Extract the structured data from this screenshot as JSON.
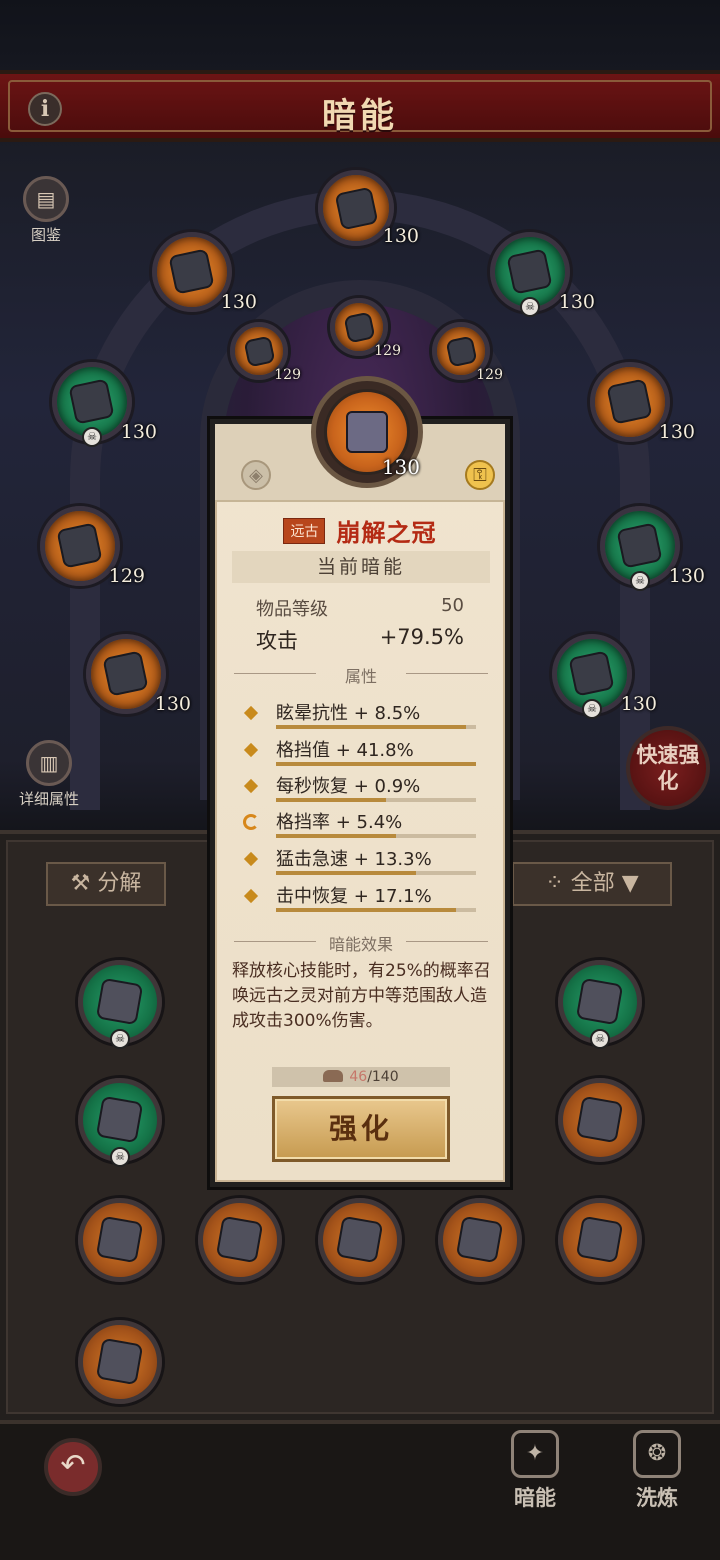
{
  "header": {
    "title": "暗能",
    "info_icon": "i"
  },
  "side": {
    "codex_label": "图鉴",
    "details_label": "详细属性",
    "quick_upgrade_label": "快速强化"
  },
  "ring_slots": [
    {
      "level": "130",
      "color": "orange"
    },
    {
      "level": "130",
      "color": "orange"
    },
    {
      "level": "130",
      "color": "green"
    },
    {
      "level": "129",
      "color": "orange"
    },
    {
      "level": "129",
      "color": "orange"
    },
    {
      "level": "129",
      "color": "orange"
    },
    {
      "level": "130",
      "color": "green"
    },
    {
      "level": "130",
      "color": "orange"
    },
    {
      "level": "129",
      "color": "orange"
    },
    {
      "level": "130",
      "color": "green"
    },
    {
      "level": "130",
      "color": "orange"
    },
    {
      "level": "130",
      "color": "green"
    }
  ],
  "lower": {
    "dismantle_label": "分解",
    "filter_label": "全部"
  },
  "popup": {
    "item_level": "130",
    "rarity": "远古",
    "item_name": "崩解之冠",
    "section_current": "当前暗能",
    "item_level_label": "物品等级",
    "item_level_value": "50",
    "attack_label": "攻击",
    "attack_value": "+79.5%",
    "attributes_title": "属性",
    "attributes": [
      {
        "text": "眩晕抗性 + 8.5%",
        "fill": 0.95
      },
      {
        "text": "格挡值 + 41.8%",
        "fill": 1.0
      },
      {
        "text": "每秒恢复 + 0.9%",
        "fill": 0.55
      },
      {
        "text": "格挡率 + 5.4%",
        "fill": 0.6
      },
      {
        "text": "猛击急速 + 13.3%",
        "fill": 0.7
      },
      {
        "text": "击中恢复 + 17.1%",
        "fill": 0.9
      }
    ],
    "effect_title": "暗能效果",
    "effect_text": "释放核心技能时，有25%的概率召唤远古之灵对前方中等范围敌人造成攻击300%伤害。",
    "cost_have": "46",
    "cost_need": "/140",
    "upgrade_label": "强化"
  },
  "tabs": {
    "dark_energy": "暗能",
    "refine": "洗炼"
  },
  "colors": {
    "accent": "#b42a14",
    "panel": "#ecdfc8",
    "title_bar": "#6c1414"
  }
}
